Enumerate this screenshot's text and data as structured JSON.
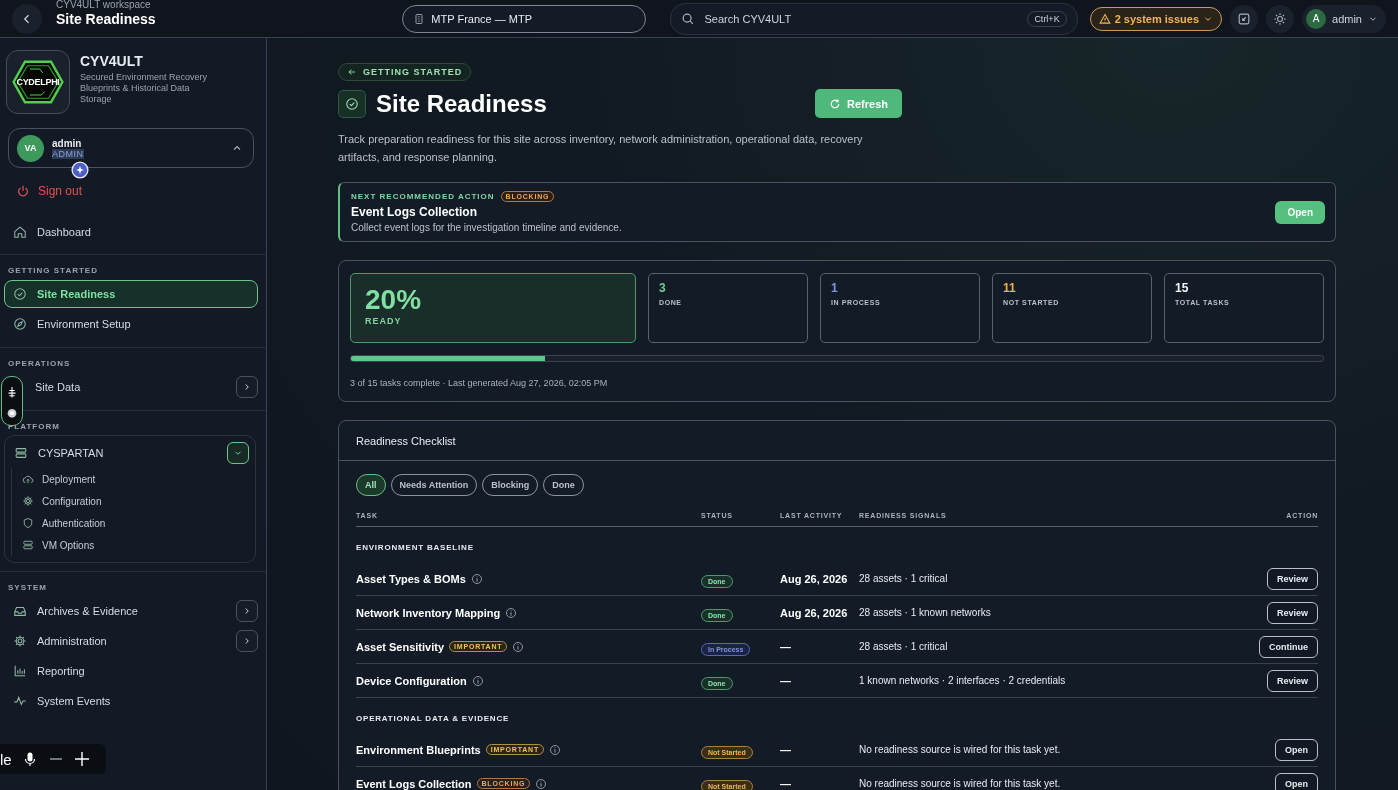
{
  "topbar": {
    "workspace": "CYV4ULT workspace",
    "title": "Site Readiness",
    "site": "MTP France — MTP",
    "search": {
      "placeholder": "Search CYV4ULT"
    },
    "shortcut": "Ctrl+K",
    "issues": "2 system issues",
    "user": {
      "initial": "A",
      "name": "admin"
    }
  },
  "sidebar": {
    "brand": {
      "logo_text": "CYDELPHI",
      "name": "CYV4ULT",
      "tagline": "Secured Environment Recovery Blueprints & Historical Data Storage"
    },
    "user": {
      "initials": "VA",
      "name": "admin",
      "role": "ADMIN",
      "expanded": true
    },
    "sign_out": "Sign out",
    "top_items": [
      {
        "label": "Dashboard",
        "selected": false
      }
    ],
    "sections": [
      {
        "title": "GETTING STARTED",
        "items": [
          {
            "label": "Site Readiness",
            "selected": true,
            "kind": "link"
          },
          {
            "label": "Environment Setup",
            "selected": false,
            "kind": "link"
          }
        ]
      },
      {
        "title": "OPERATIONS",
        "items": [
          {
            "label": "Site Data",
            "selected": false,
            "kind": "expandable",
            "expanded": false
          }
        ]
      },
      {
        "title": "PLATFORM",
        "items": [
          {
            "label": "CYSPARTAN",
            "selected": false,
            "kind": "expandable",
            "expanded": true,
            "children": [
              {
                "label": "Deployment",
                "selected": false
              },
              {
                "label": "Configuration",
                "selected": false
              },
              {
                "label": "Authentication",
                "selected": false
              },
              {
                "label": "VM Options",
                "selected": false
              }
            ]
          }
        ]
      },
      {
        "title": "SYSTEM",
        "items": [
          {
            "label": "Archives & Evidence",
            "selected": false,
            "kind": "expandable",
            "expanded": false
          },
          {
            "label": "Administration",
            "selected": false,
            "kind": "expandable",
            "expanded": false
          },
          {
            "label": "Reporting",
            "selected": false,
            "kind": "link"
          },
          {
            "label": "System Events",
            "selected": false,
            "kind": "link"
          }
        ]
      }
    ]
  },
  "dictation": {
    "text": "le"
  },
  "page": {
    "breadcrumb": "GETTING STARTED",
    "title": "Site Readiness",
    "refresh": "Refresh",
    "description": "Track preparation readiness for this site across inventory, network administration, operational data, recovery artifacts, and response planning.",
    "next_action": {
      "eyebrow": "NEXT RECOMMENDED ACTION",
      "badge": {
        "label": "BLOCKING",
        "kind": "blocking"
      },
      "title": "Event Logs Collection",
      "description": "Collect event logs for the investigation timeline and evidence.",
      "button": "Open"
    },
    "summary": {
      "percent": "20%",
      "label": "READY",
      "level": 0.2,
      "stats": [
        {
          "value": "3",
          "label": "DONE",
          "color": "#6fcf8e"
        },
        {
          "value": "1",
          "label": "IN PROCESS",
          "color": "#7f93e0"
        },
        {
          "value": "11",
          "label": "NOT STARTED",
          "color": "#e9b450"
        },
        {
          "value": "15",
          "label": "TOTAL TASKS",
          "color": "#f2f4f7"
        }
      ],
      "footnote": "3 of 15 tasks complete · Last generated Aug 27, 2026, 02:05 PM"
    },
    "checklist": {
      "title": "Readiness Checklist",
      "filters": [
        {
          "label": "All",
          "selected": true
        },
        {
          "label": "Needs Attention",
          "selected": false
        },
        {
          "label": "Blocking",
          "selected": false
        },
        {
          "label": "Done",
          "selected": false
        }
      ],
      "columns": [
        "TASK",
        "STATUS",
        "LAST ACTIVITY",
        "READINESS SIGNALS",
        "ACTION"
      ],
      "groups": [
        {
          "title": "ENVIRONMENT BASELINE",
          "rows": [
            {
              "task": "Asset Types & BOMs",
              "status": {
                "label": "Done",
                "kind": "done"
              },
              "last_activity": "Aug 26, 2026",
              "signals": "28 assets · 1 critical",
              "action": "Review"
            },
            {
              "task": "Network Inventory Mapping",
              "status": {
                "label": "Done",
                "kind": "done"
              },
              "last_activity": "Aug 26, 2026",
              "signals": "28 assets · 1 known networks",
              "action": "Review"
            },
            {
              "task": "Asset Sensitivity",
              "badge": {
                "label": "IMPORTANT",
                "kind": "important"
              },
              "status": {
                "label": "In Process",
                "kind": "in_process"
              },
              "last_activity": "—",
              "signals": "28 assets · 1 critical",
              "action": "Continue"
            },
            {
              "task": "Device Configuration",
              "status": {
                "label": "Done",
                "kind": "done"
              },
              "last_activity": "—",
              "signals": "1 known networks · 2 interfaces · 2 credentials",
              "action": "Review"
            }
          ]
        },
        {
          "title": "OPERATIONAL DATA & EVIDENCE",
          "rows": [
            {
              "task": "Environment Blueprints",
              "badge": {
                "label": "IMPORTANT",
                "kind": "important"
              },
              "status": {
                "label": "Not Started",
                "kind": "not_started"
              },
              "last_activity": "—",
              "signals": "No readiness source is wired for this task yet.",
              "action": "Open"
            },
            {
              "task": "Event Logs Collection",
              "badge": {
                "label": "BLOCKING",
                "kind": "blocking"
              },
              "status": {
                "label": "Not Started",
                "kind": "not_started"
              },
              "last_activity": "—",
              "signals": "No readiness source is wired for this task yet.",
              "action": "Open"
            }
          ]
        }
      ]
    }
  }
}
